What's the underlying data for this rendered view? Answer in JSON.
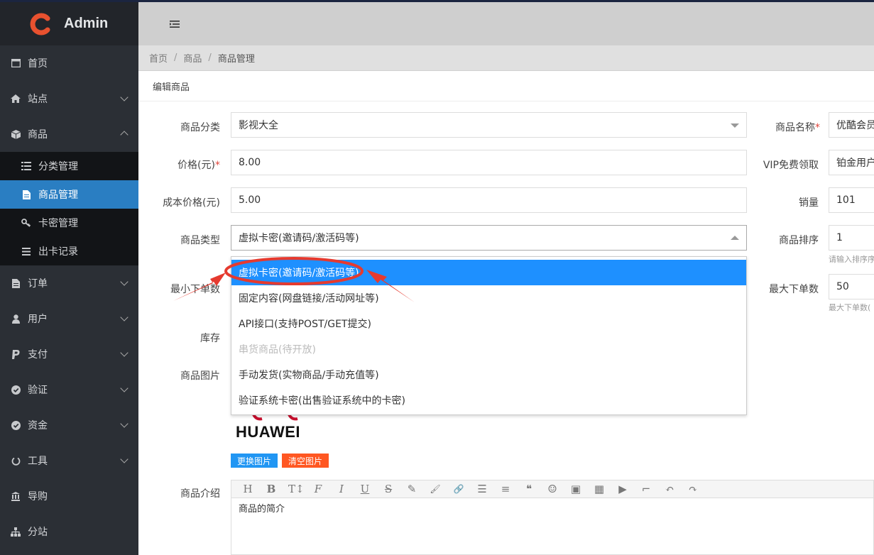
{
  "brand": {
    "name": "Admin"
  },
  "sidebar": {
    "items": [
      {
        "label": "首页",
        "icon": "window-icon"
      },
      {
        "label": "站点",
        "icon": "home-icon"
      },
      {
        "label": "商品",
        "icon": "cube-icon"
      },
      {
        "label": "订单",
        "icon": "file-icon"
      },
      {
        "label": "用户",
        "icon": "user-icon"
      },
      {
        "label": "支付",
        "icon": "paypal-icon"
      },
      {
        "label": "验证",
        "icon": "check-circle-icon"
      },
      {
        "label": "资金",
        "icon": "check-circle-icon"
      },
      {
        "label": "工具",
        "icon": "power-icon"
      },
      {
        "label": "导购",
        "icon": "bank-icon"
      },
      {
        "label": "分站",
        "icon": "sitemap-icon"
      }
    ],
    "sub_items": [
      {
        "label": "分类管理",
        "icon": "list-icon"
      },
      {
        "label": "商品管理",
        "icon": "file-text-icon",
        "active": true
      },
      {
        "label": "卡密管理",
        "icon": "key-icon"
      },
      {
        "label": "出卡记录",
        "icon": "bars-icon"
      }
    ]
  },
  "breadcrumb": {
    "home": "首页",
    "section": "商品",
    "current": "商品管理",
    "sep": "/"
  },
  "card": {
    "title": "编辑商品"
  },
  "form": {
    "category_label": "商品分类",
    "category_value": "影视大全",
    "name_label": "商品名称",
    "name_value": "优酷会员",
    "price_label": "价格(元)",
    "price_value": "8.00",
    "vip_label": "VIP免费领取",
    "vip_value": "铂金用户",
    "cost_label": "成本价格(元)",
    "cost_value": "5.00",
    "sales_label": "销量",
    "sales_value": "101",
    "type_label": "商品类型",
    "type_value": "虚拟卡密(邀请码/激活码等)",
    "sort_label": "商品排序",
    "sort_value": "1",
    "sort_hint": "请输入排序序",
    "min_label": "最小下单数",
    "max_label": "最大下单数",
    "max_value": "50",
    "max_hint": "最大下单数(",
    "stock_label": "库存",
    "image_label": "商品图片",
    "image_text": "HUAWEI",
    "change_image_btn": "更换图片",
    "clear_image_btn": "清空图片",
    "intro_label": "商品介绍",
    "intro_value": "商品的简介",
    "required_mark": "*"
  },
  "type_options": [
    {
      "label": "虚拟卡密(邀请码/激活码等)",
      "state": "selected"
    },
    {
      "label": "固定内容(网盘链接/活动网址等)",
      "state": "normal"
    },
    {
      "label": "API接口(支持POST/GET提交)",
      "state": "normal"
    },
    {
      "label": "串货商品(待开放)",
      "state": "disabled"
    },
    {
      "label": "手动发货(实物商品/手动充值等)",
      "state": "normal"
    },
    {
      "label": "验证系统卡密(出售验证系统中的卡密)",
      "state": "normal"
    }
  ],
  "editor_toolbar": [
    "H",
    "B",
    "T↕",
    "F",
    "I",
    "U",
    "S",
    "✎",
    "🖌",
    "🔗",
    "☰",
    "≡",
    "❝",
    "☺",
    "▣",
    "▦",
    "▶",
    "⌐",
    "↶",
    "↷"
  ],
  "colors": {
    "accent": "#2a7ec2",
    "selected_option": "#1e90ff",
    "annotation": "#e53a2f",
    "change_btn": "#2196f3",
    "clear_btn": "#ff5722"
  }
}
